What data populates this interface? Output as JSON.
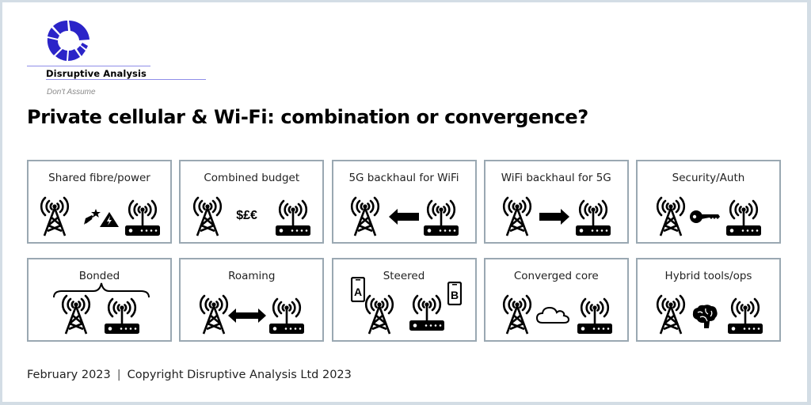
{
  "brand": {
    "name": "Disruptive Analysis",
    "tagline": "Don't Assume",
    "accent_color": "#2b24c8",
    "rule_color": "#8f8ee8"
  },
  "title": "Private cellular & Wi-Fi: combination or convergence?",
  "cards": [
    {
      "label": "Shared fibre/power",
      "middle_icon": "shooting-star-and-high-voltage-icon"
    },
    {
      "label": "Combined budget",
      "middle_icon": "currency-symbols",
      "middle_text": "$£€"
    },
    {
      "label": "5G backhaul for WiFi",
      "middle_icon": "arrow-left-icon"
    },
    {
      "label": "WiFi backhaul for 5G",
      "middle_icon": "arrow-right-icon"
    },
    {
      "label": "Security/Auth",
      "middle_icon": "key-icon"
    },
    {
      "label": "Bonded",
      "middle_icon": "curly-brace-icon"
    },
    {
      "label": "Roaming",
      "middle_icon": "double-arrow-icon"
    },
    {
      "label": "Steered",
      "middle_icon": "phones-a-b-icon",
      "phone_a": "A",
      "phone_b": "B"
    },
    {
      "label": "Converged core",
      "middle_icon": "cloud-icon"
    },
    {
      "label": "Hybrid tools/ops",
      "middle_icon": "brain-icon"
    }
  ],
  "footer": {
    "date": "February 2023",
    "separator": "|",
    "copyright": "Copyright Disruptive Analysis Ltd 2023"
  }
}
